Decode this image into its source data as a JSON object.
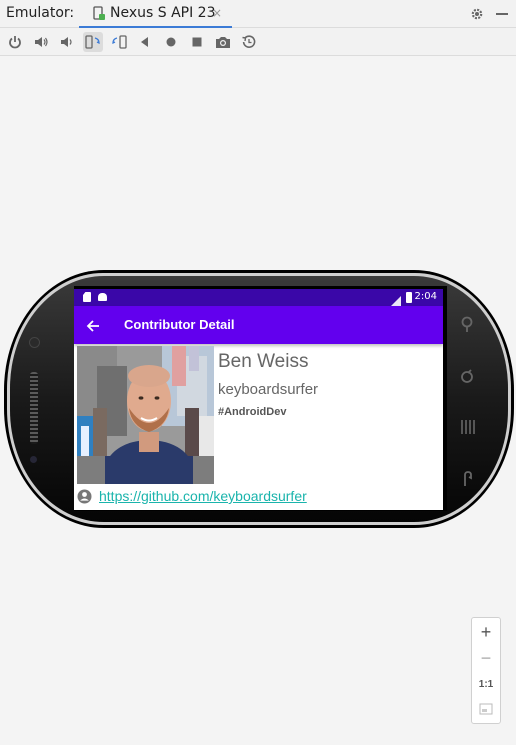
{
  "header": {
    "title": "Emulator:",
    "tab_label": "Nexus S API 23",
    "tab_close": "×"
  },
  "toolbar": {
    "buttons": [
      "power-icon",
      "volume-up-icon",
      "volume-down-icon",
      "rotate-left-icon",
      "rotate-right-icon",
      "back-icon",
      "home-icon",
      "overview-icon",
      "camera-icon",
      "snapshot-icon"
    ]
  },
  "device": {
    "status_time": "2:04",
    "app_title": "Contributor Detail",
    "contributor": {
      "name": "Ben Weiss",
      "login": "keyboardsurfer",
      "tag": "#AndroidDev",
      "url": "https://github.com/keyboardsurfer"
    }
  },
  "zoom": {
    "in": "+",
    "out": "−",
    "actual": "1:1"
  },
  "colors": {
    "appbar": "#6200ee",
    "statusbar": "#3a07a8",
    "link": "#1ab4ac",
    "tab_underline": "#3c7bd6"
  }
}
